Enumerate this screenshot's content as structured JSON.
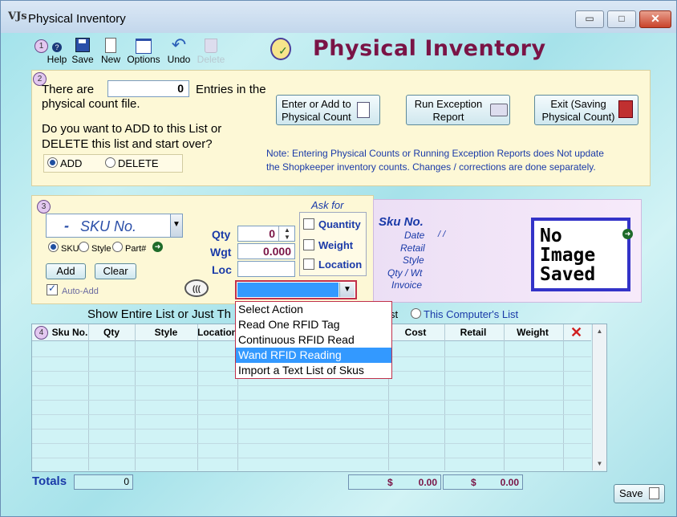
{
  "window": {
    "title": "Physical Inventory",
    "app_icon_label": "VJs",
    "controls": {
      "minimize": "▭",
      "maximize": "□",
      "close": "✕"
    }
  },
  "toolbar": {
    "step": "1",
    "help": "Help",
    "save": "Save",
    "new": "New",
    "options": "Options",
    "undo": "Undo",
    "delete": "Delete"
  },
  "header": {
    "title": "Physical Inventory"
  },
  "section2": {
    "step": "2",
    "there_are": "There are",
    "entries_count": "0",
    "entries_in_the": "Entries in the",
    "physical_count_file": "physical count file.",
    "question_line1": "Do you want to ADD to this List or",
    "question_line2": "DELETE this list and start over?",
    "opt_add": "ADD",
    "opt_delete": "DELETE",
    "btn_enter_line1": "Enter or Add to",
    "btn_enter_line2": "Physical Count",
    "btn_run_line1": "Run Exception",
    "btn_run_line2": "Report",
    "btn_exit_line1": "Exit (Saving",
    "btn_exit_line2": "Physical Count)",
    "note_line1": "Note: Entering Physical Counts or Running Exception Reports does Not  update",
    "note_line2": "the Shopkeeper inventory counts. Changes / corrections are done separately."
  },
  "section3": {
    "step": "3",
    "sku_dash": "-",
    "sku_placeholder": "SKU No.",
    "opt_sku": "SKU",
    "opt_style": "Style",
    "opt_part": "Part#",
    "btn_add": "Add",
    "btn_clear": "Clear",
    "auto_add": "Auto-Add",
    "qty_label": "Qty",
    "qty_value": "0",
    "wgt_label": "Wgt",
    "wgt_value": "0.000",
    "loc_label": "Loc",
    "ask_for": "Ask for",
    "ask_quantity": "Quantity",
    "ask_weight": "Weight",
    "ask_location": "Location"
  },
  "sku_info": {
    "sku_no": "Sku No.",
    "date": "Date",
    "date_value": "/ /",
    "retail": "Retail",
    "style": "Style",
    "qty_wt": "Qty / Wt",
    "invoice": "Invoice",
    "no_image_l1": "No",
    "no_image_l2": "Image",
    "no_image_l3": "Saved"
  },
  "action_dropdown": {
    "options": [
      "Select Action",
      "Read One RFID Tag",
      "Continuous RFID Read",
      "Wand RFID Reading",
      "Import a Text List of Skus"
    ],
    "highlighted_index": 3
  },
  "show_list": {
    "label": "Show Entire List or Just Th",
    "suffix": "st",
    "this_computer": "This Computer's List"
  },
  "grid": {
    "step": "4",
    "columns": [
      "Sku No.",
      "Qty",
      "Style",
      "Location",
      "Cost",
      "Retail",
      "Weight"
    ]
  },
  "totals": {
    "label": "Totals",
    "qty_total": "0",
    "cost_currency": "$",
    "cost_total": "0.00",
    "retail_currency": "$",
    "retail_total": "0.00"
  },
  "footer": {
    "save": "Save"
  }
}
